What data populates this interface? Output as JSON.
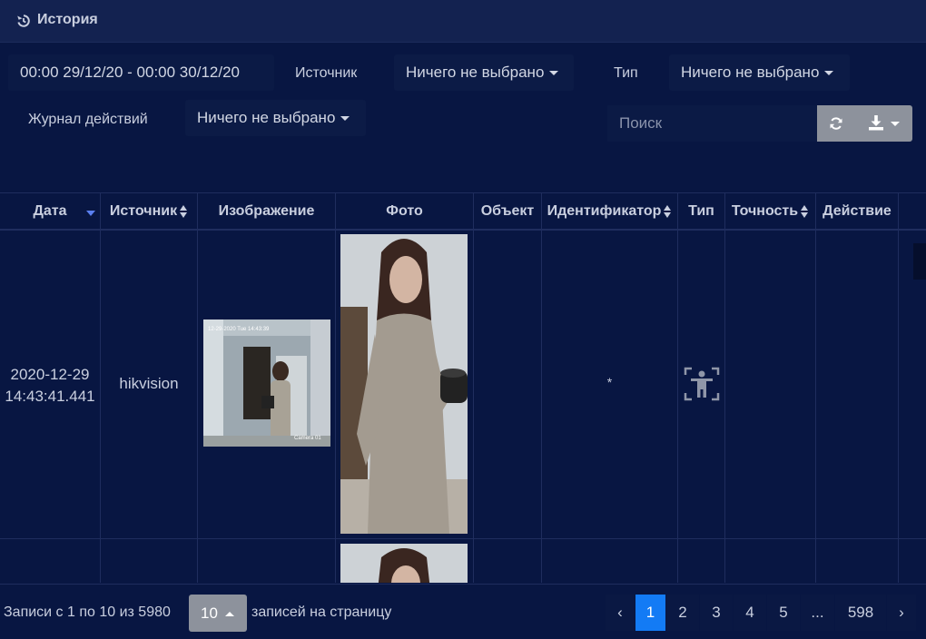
{
  "header": {
    "title": "История",
    "icon": "history-icon"
  },
  "filters": {
    "date_range": "00:00 29/12/20 - 00:00 30/12/20",
    "source_label": "Источник",
    "source_value": "Ничего не выбрано",
    "type_label": "Тип",
    "type_value": "Ничего не выбрано",
    "journal_label": "Журнал действий",
    "journal_value": "Ничего не выбрано",
    "search_placeholder": "Поиск"
  },
  "toolbar": {
    "refresh_icon": "refresh-icon",
    "download_icon": "download-icon"
  },
  "table": {
    "columns": [
      "Дата",
      "Источник",
      "Изображение",
      "Фото",
      "Объект",
      "Идентификатор",
      "Тип",
      "Точность",
      "Действие"
    ],
    "rows": [
      {
        "date": "2020-12-29",
        "time": "14:43:41.441",
        "source": "hikvision",
        "object": "",
        "identifier": "*",
        "type_icon": "person-detection-icon",
        "accuracy": "",
        "action": "",
        "overlay_ts": "12-29-2020 Tue 14:43:39",
        "overlay_cam": "Camera 01"
      }
    ]
  },
  "footer": {
    "records_text": "Записи с 1 по 10 из 5980",
    "page_size": "10",
    "per_page_text": "записей на страницу",
    "pages": [
      "‹",
      "1",
      "2",
      "3",
      "4",
      "5",
      "...",
      "598",
      "›"
    ],
    "current_page": "1"
  },
  "colors": {
    "background": "#081642",
    "header": "#132250",
    "accent": "#137bf5",
    "button": "#8d929c"
  }
}
